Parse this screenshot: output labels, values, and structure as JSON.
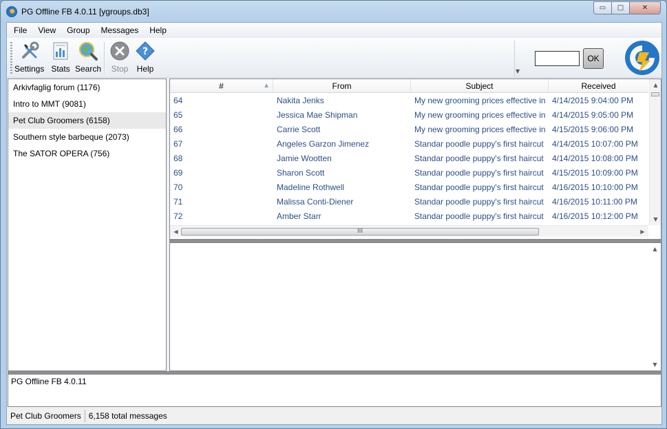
{
  "window": {
    "title": "PG Offline FB 4.0.11  [ygroups.db3]",
    "minimize_glyph": "▭",
    "maximize_glyph": "□",
    "close_glyph": "✕"
  },
  "menu": [
    "File",
    "View",
    "Group",
    "Messages",
    "Help"
  ],
  "toolbar": {
    "settings_label": "Settings",
    "stats_label": "Stats",
    "search_label": "Search",
    "stop_label": "Stop",
    "help_label": "Help",
    "search_value": "",
    "ok_label": "OK"
  },
  "groups": [
    {
      "label": "Arkivfaglig forum (1176)",
      "selected": false
    },
    {
      "label": "Intro to MMT (9081)",
      "selected": false
    },
    {
      "label": "Pet Club Groomers (6158)",
      "selected": true
    },
    {
      "label": "Southern style barbeque (2073)",
      "selected": false
    },
    {
      "label": "The SATOR OPERA (756)",
      "selected": false
    }
  ],
  "grid": {
    "columns": [
      "#",
      "From",
      "Subject",
      "Received"
    ],
    "sort_glyph": "▲",
    "rows": [
      [
        "64",
        "Nakita Jenks",
        "My new grooming prices effective in",
        "4/14/2015 9:04:00 PM"
      ],
      [
        "65",
        "Jessica Mae Shipman",
        "My new grooming prices effective in",
        "4/14/2015 9:05:00 PM"
      ],
      [
        "66",
        "Carrie Scott",
        "My new grooming prices effective in",
        "4/15/2015 9:06:00 PM"
      ],
      [
        "67",
        "Angeles Garzon Jimenez",
        "Standar poodle puppy's first haircut",
        "4/14/2015 10:07:00 PM"
      ],
      [
        "68",
        "Jamie Wootten",
        "Standar poodle puppy's first haircut",
        "4/14/2015 10:08:00 PM"
      ],
      [
        "69",
        "Sharon Scott",
        "Standar poodle puppy's first haircut",
        "4/15/2015 10:09:00 PM"
      ],
      [
        "70",
        "Madeline Rothwell",
        "Standar poodle puppy's first haircut",
        "4/16/2015 10:10:00 PM"
      ],
      [
        "71",
        "Malissa Conti-Diener",
        "Standar poodle puppy's first haircut",
        "4/16/2015 10:11:00 PM"
      ],
      [
        "72",
        "Amber Starr",
        "Standar poodle puppy's first haircut",
        "4/16/2015 10:12:00 PM"
      ]
    ],
    "scroll_up": "▲",
    "scroll_down": "▼",
    "scroll_left": "◀",
    "scroll_right": "▶",
    "hthumb_grip": "III"
  },
  "log": {
    "text": "PG Offline FB 4.0.11"
  },
  "status": {
    "group": "Pet Club Groomers",
    "total": "6,158 total messages"
  },
  "colors": {
    "link_text": "#2b4f8a",
    "logo_blue": "#2676c7",
    "logo_yellow": "#f2b81e"
  }
}
